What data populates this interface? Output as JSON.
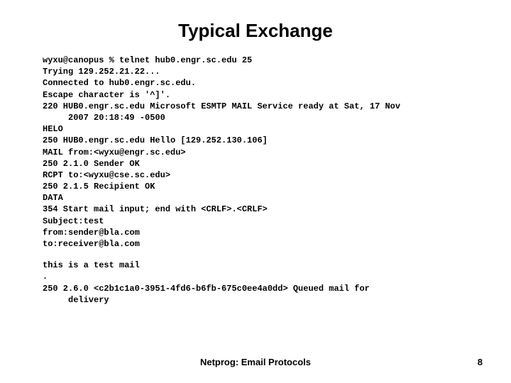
{
  "title": "Typical Exchange",
  "lines": [
    {
      "text": "wyxu@canopus % telnet hub0.engr.sc.edu 25",
      "indent": false
    },
    {
      "text": "Trying 129.252.21.22...",
      "indent": false
    },
    {
      "text": "Connected to hub0.engr.sc.edu.",
      "indent": false
    },
    {
      "text": "Escape character is '^]'.",
      "indent": false
    },
    {
      "text": "220 HUB0.engr.sc.edu Microsoft ESMTP MAIL Service ready at Sat, 17 Nov",
      "indent": false
    },
    {
      "text": "2007 20:18:49 -0500",
      "indent": true
    },
    {
      "text": "HELO",
      "indent": false
    },
    {
      "text": "250 HUB0.engr.sc.edu Hello [129.252.130.106]",
      "indent": false
    },
    {
      "text": "MAIL from:<wyxu@engr.sc.edu>",
      "indent": false
    },
    {
      "text": "250 2.1.0 Sender OK",
      "indent": false
    },
    {
      "text": "RCPT to:<wyxu@cse.sc.edu>",
      "indent": false
    },
    {
      "text": "250 2.1.5 Recipient OK",
      "indent": false
    },
    {
      "text": "DATA",
      "indent": false
    },
    {
      "text": "354 Start mail input; end with <CRLF>.<CRLF>",
      "indent": false
    },
    {
      "text": "Subject:test",
      "indent": false
    },
    {
      "text": "from:sender@bla.com",
      "indent": false
    },
    {
      "text": "to:receiver@bla.com",
      "indent": false
    }
  ],
  "lines2": [
    {
      "text": "this is a test mail",
      "indent": false
    },
    {
      "text": ".",
      "indent": false
    },
    {
      "text": "250 2.6.0 <c2b1c1a0-3951-4fd6-b6fb-675c0ee4a0dd> Queued mail for",
      "indent": false
    },
    {
      "text": "delivery",
      "indent": true
    }
  ],
  "footer": "Netprog:  Email Protocols",
  "page": "8"
}
